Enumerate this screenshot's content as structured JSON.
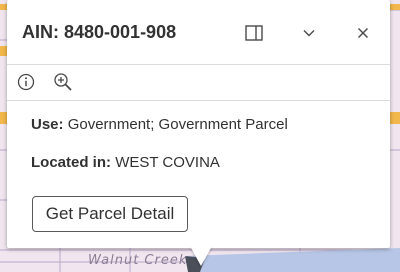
{
  "popup": {
    "title": "AIN: 8480-001-908",
    "header_buttons": [
      "dock-icon",
      "chevron-down-icon",
      "close-icon"
    ],
    "toolbar_icons": [
      "info-icon",
      "zoom-in-icon"
    ],
    "fields": [
      {
        "label": "Use:",
        "value": "Government; Government Parcel"
      },
      {
        "label": "Located in:",
        "value": "WEST COVINA"
      }
    ],
    "action_button": "Get Parcel Detail"
  },
  "map": {
    "label": "Walnut Creek",
    "colors": {
      "parcel_fill": "#f1e6ef",
      "road": "#f2b84b",
      "parcel_line": "#b9a6c9",
      "water": "#b7c6e6"
    }
  }
}
